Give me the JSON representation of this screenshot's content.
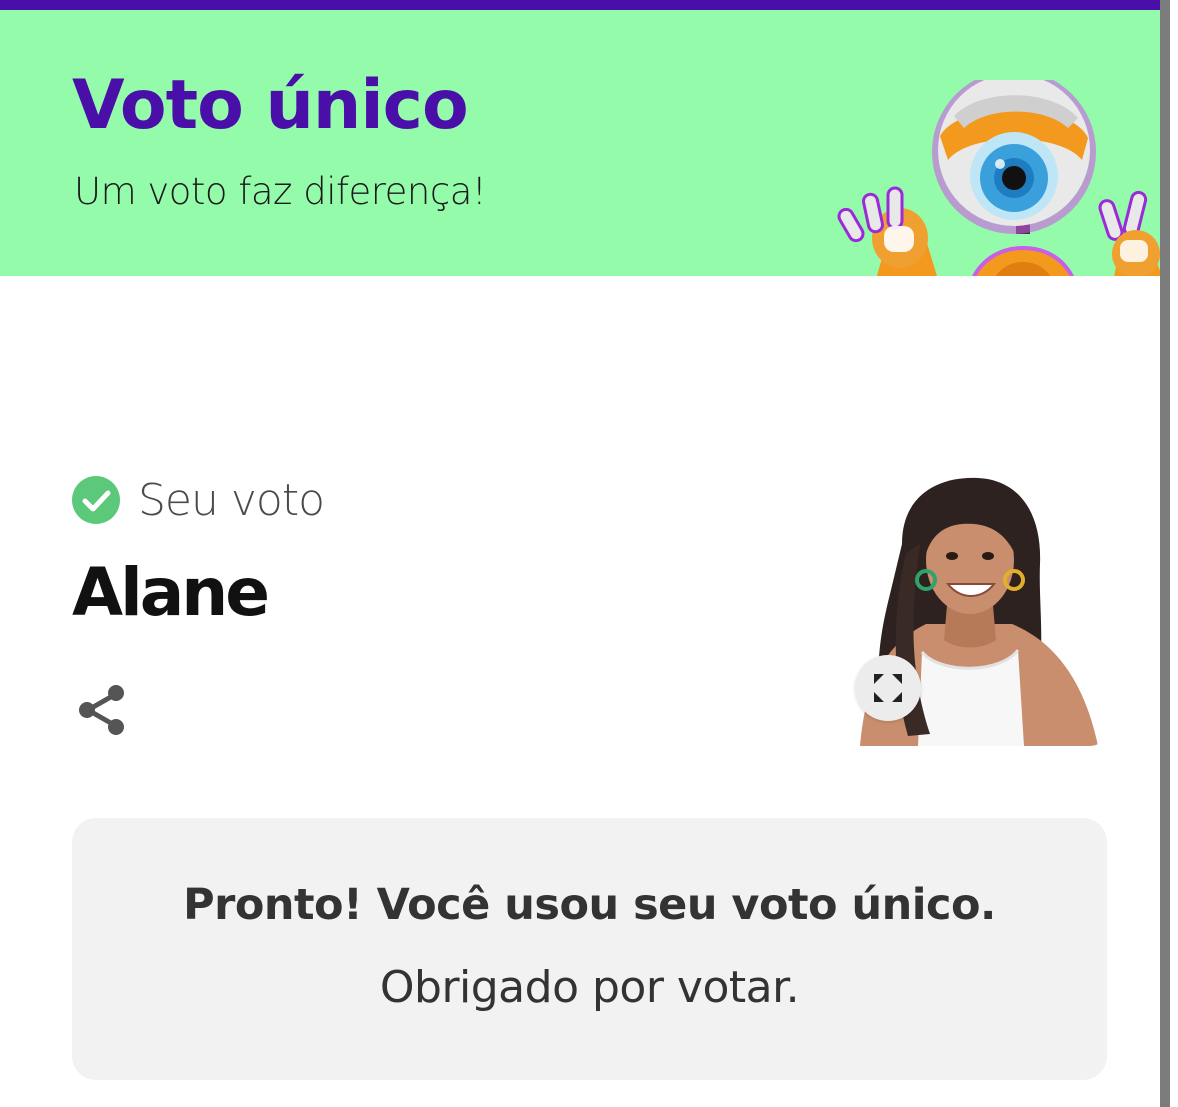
{
  "colors": {
    "brand_purple": "#4a0fa8",
    "header_green": "#94fbab",
    "success_green": "#5cc87a",
    "card_background": "#f2f2f2"
  },
  "header": {
    "title": "Voto único",
    "subtitle": "Um voto faz diferença!",
    "mascot_icon": "big-brother-eye-robot"
  },
  "vote": {
    "status_icon": "check-circle-icon",
    "status_label": "Seu voto",
    "candidate_name": "Alane",
    "share_icon": "share-icon",
    "expand_icon": "expand-icon"
  },
  "confirmation": {
    "title": "Pronto! Você usou seu voto único.",
    "message": "Obrigado por votar."
  }
}
